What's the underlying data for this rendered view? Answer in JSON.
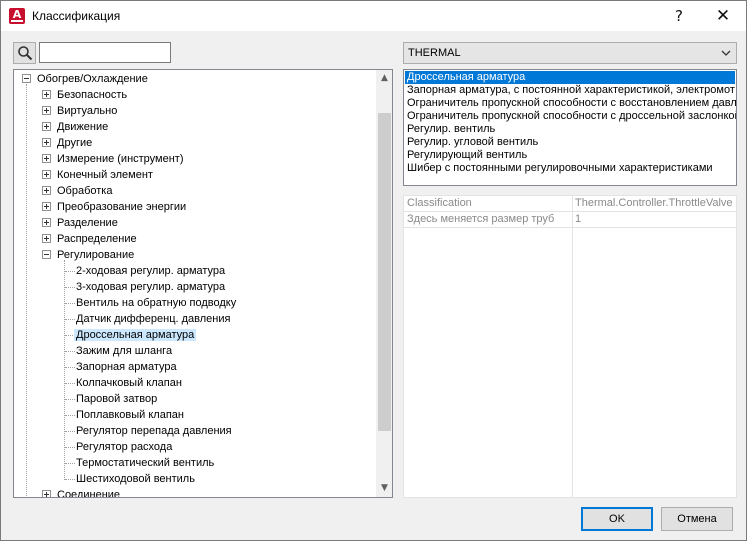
{
  "window": {
    "title": "Классификация",
    "app_icon_letter": "A",
    "help_glyph": "?",
    "close_glyph": "✕"
  },
  "search": {
    "value": "",
    "placeholder": ""
  },
  "tree": {
    "root": "Обогрев/Охлаждение",
    "top_children": [
      "Безопасность",
      "Виртуально",
      "Движение",
      "Другие",
      "Измерение (инструмент)",
      "Конечный элемент",
      "Обработка",
      "Преобразование энергии",
      "Разделение",
      "Распределение",
      "Регулирование"
    ],
    "regulation_children": [
      "2-ходовая регулир. арматура",
      "3-ходовая регулир. арматура",
      "Вентиль на обратную подводку",
      "Датчик дифференц. давления",
      "Дроссельная арматура",
      "Зажим для шланга",
      "Запорная арматура",
      "Колпачковый клапан",
      "Паровой затвор",
      "Поплавковый клапан",
      "Регулятор перепада давления",
      "Регулятор расхода",
      "Термостатический вентиль",
      "Шестиходовой вентиль"
    ],
    "after": "Соединение",
    "selected_label": "Дроссельная арматура"
  },
  "scrollbar": {
    "up_glyph": "▲",
    "down_glyph": "▼"
  },
  "combo": {
    "value": "THERMAL"
  },
  "list": {
    "items": [
      "Дроссельная арматура",
      "Запорная арматура, с постоянной характеристикой, электромот",
      "Ограничитель пропускной способности с восстановлением давл",
      "Ограничитель пропускной способности с дроссельной заслонкой",
      "Регулир. вентиль",
      "Регулир. угловой вентиль",
      "Регулирующий вентиль",
      "Шибер с постоянными регулировочными характеристиками"
    ],
    "selected_index": 0
  },
  "properties": [
    {
      "key": "Classification",
      "value": "Thermal.Controller.ThrottleValve"
    },
    {
      "key": "Здесь меняется размер труб",
      "value": "1"
    }
  ],
  "buttons": {
    "ok": "OK",
    "cancel": "Отмена"
  },
  "colors": {
    "selection_blue": "#0078d7",
    "tree_selection": "#cce8ff",
    "app_icon_red": "#c8102e"
  }
}
